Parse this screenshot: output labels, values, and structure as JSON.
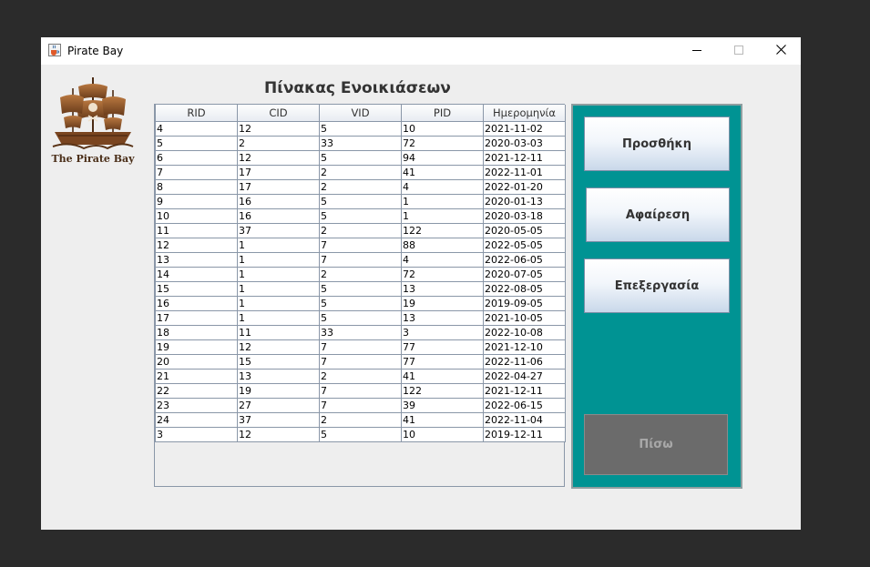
{
  "window": {
    "title": "Pirate Bay"
  },
  "logo": {
    "text": "The Pirate Bay"
  },
  "heading": "Πίνακας Ενοικιάσεων",
  "table": {
    "columns": [
      "RID",
      "CID",
      "VID",
      "PID",
      "Ημερομηνία"
    ],
    "rows": [
      [
        "4",
        "12",
        "5",
        "10",
        "2021-11-02"
      ],
      [
        "5",
        "2",
        "33",
        "72",
        "2020-03-03"
      ],
      [
        "6",
        "12",
        "5",
        "94",
        "2021-12-11"
      ],
      [
        "7",
        "17",
        "2",
        "41",
        "2022-11-01"
      ],
      [
        "8",
        "17",
        "2",
        "4",
        "2022-01-20"
      ],
      [
        "9",
        "16",
        "5",
        "1",
        "2020-01-13"
      ],
      [
        "10",
        "16",
        "5",
        "1",
        "2020-03-18"
      ],
      [
        "11",
        "37",
        "2",
        "122",
        "2020-05-05"
      ],
      [
        "12",
        "1",
        "7",
        "88",
        "2022-05-05"
      ],
      [
        "13",
        "1",
        "7",
        "4",
        "2022-06-05"
      ],
      [
        "14",
        "1",
        "2",
        "72",
        "2020-07-05"
      ],
      [
        "15",
        "1",
        "5",
        "13",
        "2022-08-05"
      ],
      [
        "16",
        "1",
        "5",
        "19",
        "2019-09-05"
      ],
      [
        "17",
        "1",
        "5",
        "13",
        "2021-10-05"
      ],
      [
        "18",
        "11",
        "33",
        "3",
        "2022-10-08"
      ],
      [
        "19",
        "12",
        "7",
        "77",
        "2021-12-10"
      ],
      [
        "20",
        "15",
        "7",
        "77",
        "2022-11-06"
      ],
      [
        "21",
        "13",
        "2",
        "41",
        "2022-04-27"
      ],
      [
        "22",
        "19",
        "7",
        "122",
        "2021-12-11"
      ],
      [
        "23",
        "27",
        "7",
        "39",
        "2022-06-15"
      ],
      [
        "24",
        "37",
        "2",
        "41",
        "2022-11-04"
      ],
      [
        "3",
        "12",
        "5",
        "10",
        "2019-12-11"
      ]
    ]
  },
  "actions": {
    "add_label": "Προσθήκη",
    "remove_label": "Αφαίρεση",
    "edit_label": "Επεξεργασία",
    "back_label": "Πίσω"
  },
  "colors": {
    "side_panel": "#009393",
    "back_button": "#6b6b6b"
  },
  "icons": {
    "app": "java-cup-icon",
    "minimize": "minimize-icon",
    "maximize": "maximize-icon",
    "close": "close-icon",
    "logo": "pirate-ship-logo"
  }
}
